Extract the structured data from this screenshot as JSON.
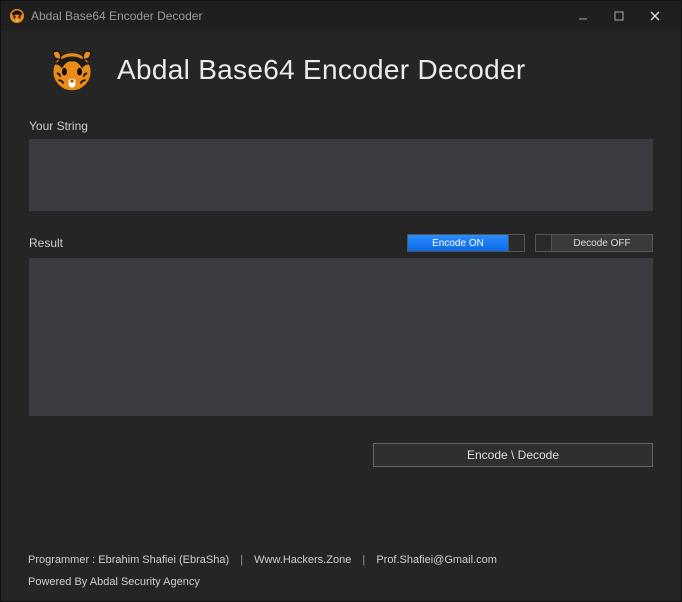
{
  "window": {
    "title": "Abdal Base64 Encoder Decoder"
  },
  "header": {
    "title": "Abdal Base64 Encoder Decoder"
  },
  "input": {
    "label": "Your String",
    "value": ""
  },
  "result": {
    "label": "Result",
    "value": ""
  },
  "toggles": {
    "encode": {
      "label": "Encode ON",
      "state": "on"
    },
    "decode": {
      "label": "Decode OFF",
      "state": "off"
    }
  },
  "actions": {
    "main_button": "Encode \\ Decode"
  },
  "footer": {
    "programmer_label": "Programmer : Ebrahim Shafiei (EbraSha)",
    "website": "Www.Hackers.Zone",
    "email": "Prof.Shafiei@Gmail.com",
    "powered": "Powered By Abdal Security Agency",
    "separator": "|"
  },
  "colors": {
    "accent": "#1e7dff",
    "panel": "#3b3c42",
    "bg": "#252525"
  }
}
